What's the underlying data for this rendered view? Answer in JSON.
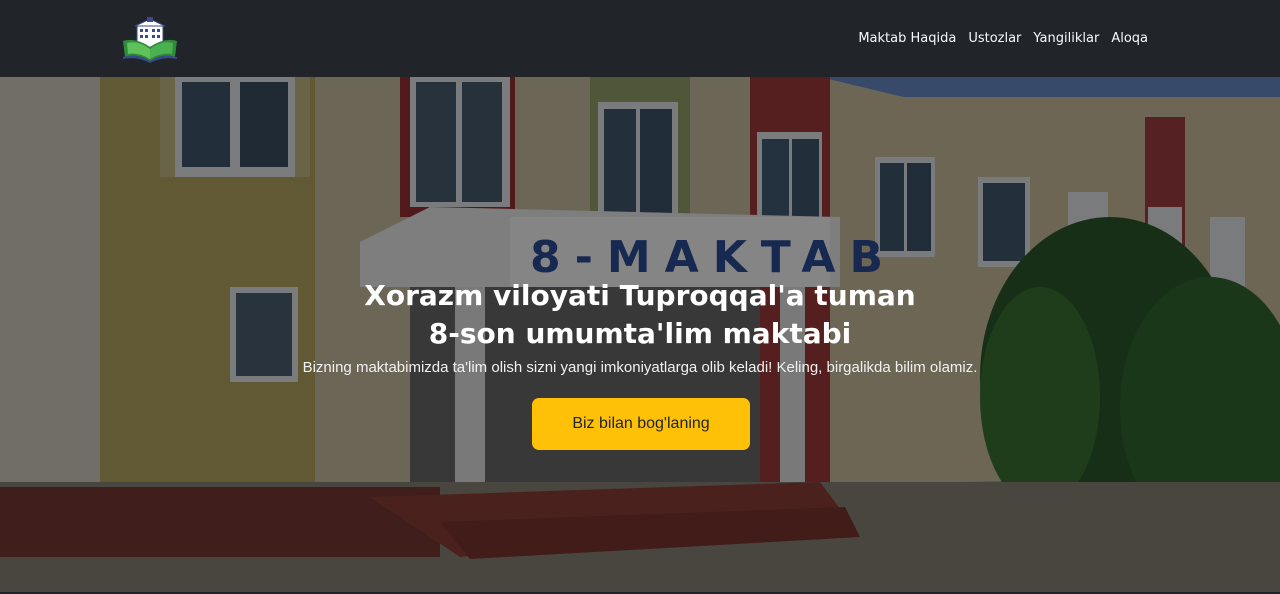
{
  "nav": {
    "logo_icon": "school-book-logo",
    "links": [
      {
        "label": "Maktab Haqida"
      },
      {
        "label": "Ustozlar"
      },
      {
        "label": "Yangiliklar"
      },
      {
        "label": "Aloqa"
      }
    ]
  },
  "hero": {
    "sign_text": "8-MAKTAB",
    "title_line1": "Xorazm viloyati Tuproqqal'a tuman",
    "title_line2": "8-son umumta'lim maktabi",
    "subtitle": "Bizning maktabimizda ta'lim olish sizni yangi imkoniyatlarga olib keladi! Keling, birgalikda bilim olamiz.",
    "button_label": "Biz bilan bog'laning"
  },
  "colors": {
    "navbar": "#212529",
    "accent": "#ffc107",
    "hero_text": "#ffffff"
  }
}
